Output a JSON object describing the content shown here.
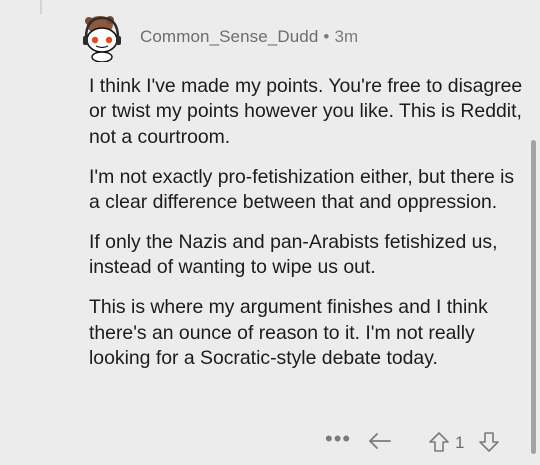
{
  "comment": {
    "author": "Common_Sense_Dudd",
    "separator": "•",
    "age": "3m",
    "avatar_icon": "snoo-avatar-icon",
    "paragraphs": [
      "I think I've made my points. You're free to disagree or twist my points however you like. This is Reddit, not a courtroom.",
      "I'm not exactly pro-fetishization either, but there is a clear difference between that and oppression.",
      "If only the Nazis and pan-Arabists fetishized us, instead of wanting to wipe us out.",
      "This is where my argument finishes and I think there's an ounce of reason to it. I'm not really looking for a Socratic-style debate today."
    ],
    "actions": {
      "more_label": "•••",
      "vote_count": "1",
      "icons": [
        "more-icon",
        "reply-icon",
        "upvote-icon",
        "downvote-icon"
      ]
    }
  },
  "colors": {
    "background": "#ececec",
    "text": "#1c1c1d",
    "meta": "#7a7b7d"
  }
}
